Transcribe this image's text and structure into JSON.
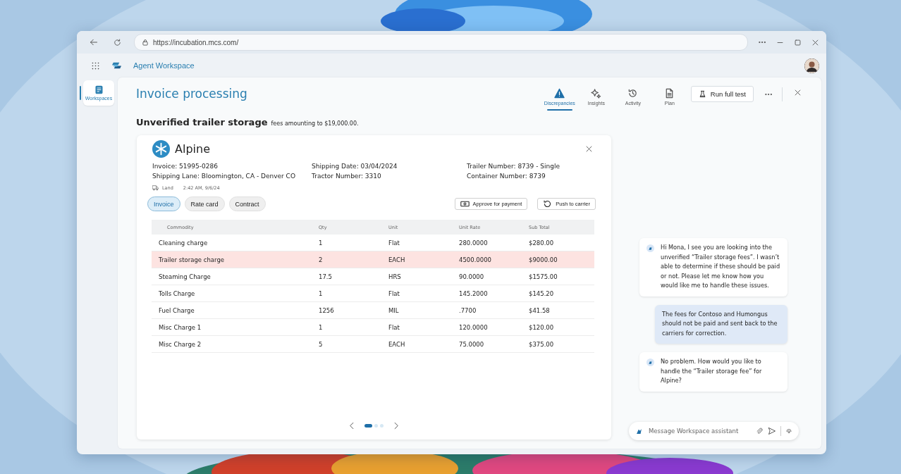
{
  "browser": {
    "url": "https://incubation.mcs.com/"
  },
  "app": {
    "title": "Agent Workspace"
  },
  "sidebar": {
    "items": [
      {
        "label": "Workspaces",
        "selected": true
      }
    ]
  },
  "page": {
    "title": "Invoice processing",
    "tabs": [
      {
        "label": "Discrepancies",
        "selected": true
      },
      {
        "label": "Insights",
        "selected": false
      },
      {
        "label": "Activity",
        "selected": false
      },
      {
        "label": "Plan",
        "selected": false
      }
    ],
    "run_button": "Run full test"
  },
  "headline": {
    "title": "Unverified trailer storage",
    "note": "fees amounting to $19,000.00."
  },
  "card": {
    "vendor": "Alpine",
    "details": [
      "Invoice: 51995-0286",
      "Shipping Date: 03/04/2024",
      "Trailer Number: 8739 - Single",
      "Shipping Lane: Bloomington, CA - Denver CO",
      "Tractor Number: 3310",
      "Container Number: 8739"
    ],
    "mode": "Land",
    "time": "2:42 AM, 9/6/24",
    "doc_tabs": [
      {
        "label": "Invoice",
        "selected": true
      },
      {
        "label": "Rate card",
        "selected": false
      },
      {
        "label": "Contract",
        "selected": false
      }
    ],
    "actions": [
      "Approve for payment",
      "Push to carrier"
    ],
    "table": {
      "columns": [
        "Commodity",
        "Qty",
        "Unit",
        "Unit Rate",
        "Sub Total"
      ],
      "rows": [
        {
          "cells": [
            "Cleaning charge",
            "1",
            "Flat",
            "280.0000",
            "$280.00"
          ],
          "flagged": false
        },
        {
          "cells": [
            "Trailer storage charge",
            "2",
            "EACH",
            "4500.0000",
            "$9000.00"
          ],
          "flagged": true
        },
        {
          "cells": [
            "Steaming Charge",
            "17.5",
            "HRS",
            "90.0000",
            "$1575.00"
          ],
          "flagged": false
        },
        {
          "cells": [
            "Tolls Charge",
            "1",
            "Flat",
            "145.2000",
            "$145.20"
          ],
          "flagged": false
        },
        {
          "cells": [
            "Fuel Charge",
            "1256",
            "MIL",
            ".7700",
            "$41.58"
          ],
          "flagged": false
        },
        {
          "cells": [
            "Misc Charge 1",
            "1",
            "Flat",
            "120.0000",
            "$120.00"
          ],
          "flagged": false
        },
        {
          "cells": [
            "Misc Charge 2",
            "5",
            "EACH",
            "75.0000",
            "$375.00"
          ],
          "flagged": false
        }
      ]
    },
    "pager": [
      {
        "selected": true
      },
      {
        "selected": false
      },
      {
        "selected": false
      }
    ]
  },
  "chat": {
    "messages": [
      {
        "kind": "assistant",
        "text": "Hi Mona, I see you are looking into the unverified “Trailer storage fees”. I wasn’t able to determine if these should be paid or not. Please let me know how you would like me to handle these issues."
      },
      {
        "kind": "user",
        "text": "The fees for Contoso and Humongus should not be paid and sent back to the carriers for correction."
      },
      {
        "kind": "assistant",
        "text": "No problem. How would you like to handle the “Trailer storage fee” for Alpine?"
      }
    ],
    "input": {
      "placeholder": "Message Workspace assistant"
    }
  }
}
